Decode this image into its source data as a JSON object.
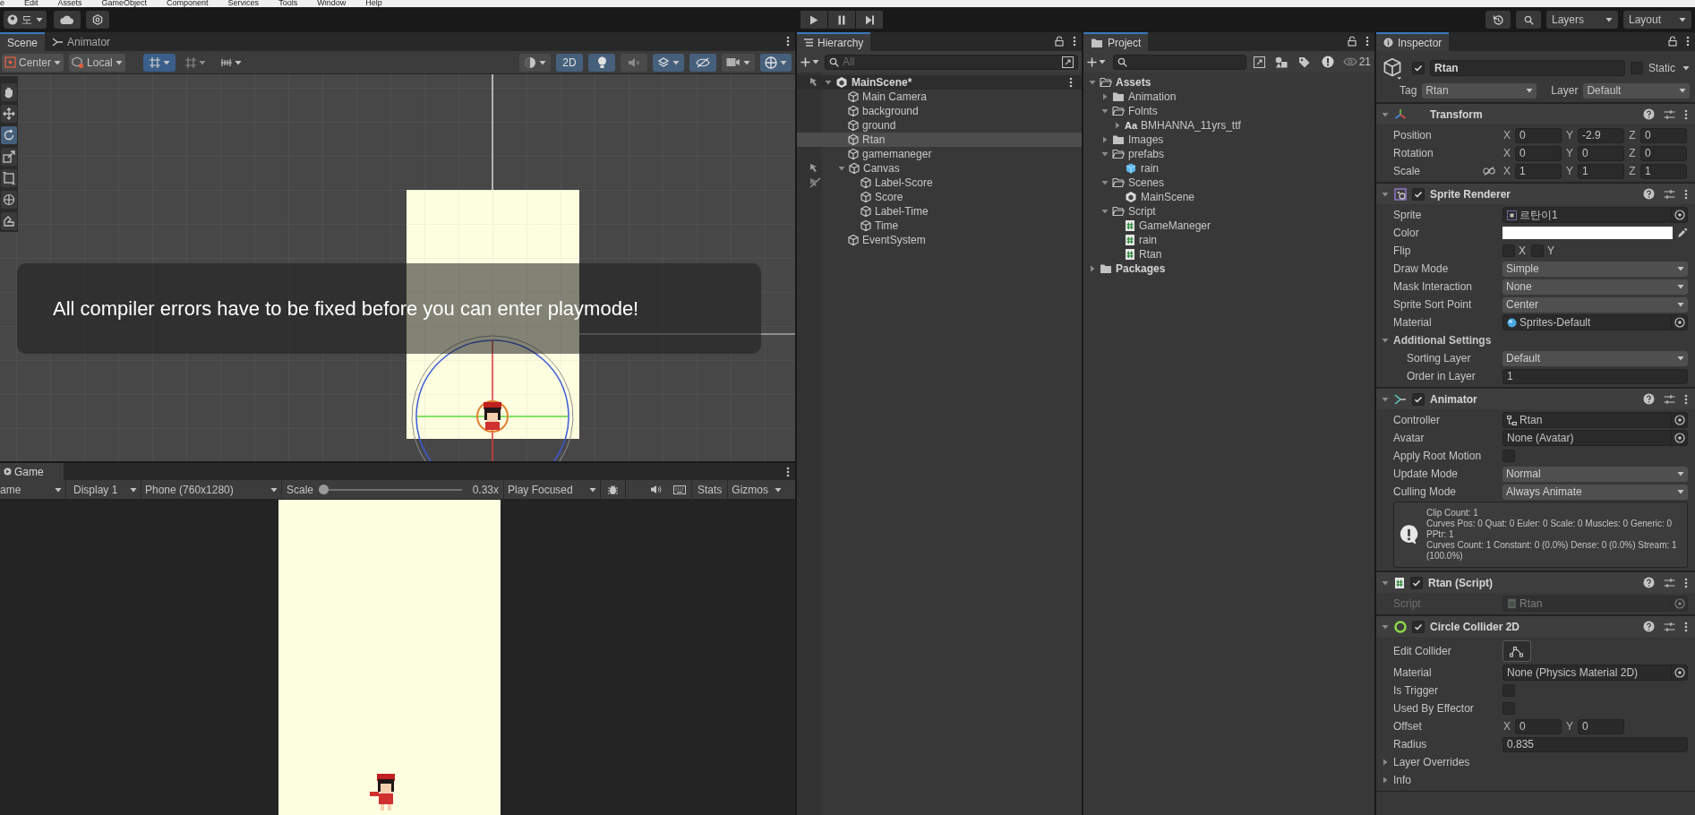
{
  "menu_bar": [
    "e",
    "Edit",
    "Assets",
    "GameObject",
    "Component",
    "Services",
    "Tools",
    "Window",
    "Help"
  ],
  "main_toolbar": {
    "account": "도",
    "layers": "Layers",
    "layout": "Layout"
  },
  "scene": {
    "tabs": [
      {
        "label": "Scene",
        "selected": true,
        "kind": "scene"
      },
      {
        "label": "Animator",
        "selected": false,
        "kind": "animator"
      }
    ],
    "pivot": "Center",
    "space": "Local",
    "toggles": [
      {
        "kind": "shading",
        "on": false
      },
      {
        "kind": "dimension",
        "label": "2D",
        "on": true
      },
      {
        "kind": "lighting",
        "on": true
      },
      {
        "kind": "audio",
        "on": false
      },
      {
        "kind": "effects",
        "on": true
      },
      {
        "kind": "visibility",
        "on": true
      },
      {
        "kind": "camera",
        "on": false
      },
      {
        "kind": "gizmos",
        "on": true
      }
    ],
    "tools": [
      {
        "kind": "hand",
        "selected": false
      },
      {
        "kind": "move",
        "selected": false
      },
      {
        "kind": "rotate",
        "selected": true
      },
      {
        "kind": "scale",
        "selected": false
      },
      {
        "kind": "rect",
        "selected": false
      },
      {
        "kind": "transform",
        "selected": false
      },
      {
        "kind": "custom",
        "selected": false
      }
    ],
    "message": "All compiler errors have to be fixed before you can enter playmode!"
  },
  "game": {
    "tab": "Game",
    "view": "ame",
    "display": "Display 1",
    "resolution": "Phone (760x1280)",
    "scale": {
      "label": "Scale",
      "level": 0,
      "value": "0.33x"
    },
    "play_mode": "Play Focused",
    "stats": "Stats",
    "gizmos": "Gizmos"
  },
  "hierarchy": {
    "title": "Hierarchy",
    "placeholder": "All",
    "scene": "MainScene*",
    "items": [
      {
        "label": "Main Camera",
        "selected": false
      },
      {
        "label": "background",
        "selected": false
      },
      {
        "label": "ground",
        "selected": false
      },
      {
        "label": "Rtan",
        "selected": true
      },
      {
        "label": "gamemaneger",
        "selected": false
      },
      {
        "label": "Canvas",
        "selected": false,
        "expanded": true,
        "pickable": true,
        "children": [
          {
            "label": "Label-Score",
            "selected": false,
            "pickable": false
          },
          {
            "label": "Score",
            "selected": false
          },
          {
            "label": "Label-Time",
            "selected": false
          },
          {
            "label": "Time",
            "selected": false
          }
        ]
      },
      {
        "label": "EventSystem",
        "selected": false
      }
    ]
  },
  "project": {
    "title": "Project",
    "count": "21",
    "items": [
      {
        "label": "Assets",
        "kind": "folder",
        "expanded": true,
        "selected": false,
        "children": [
          {
            "label": "Animation",
            "kind": "folder",
            "expanded": false,
            "selected": false
          },
          {
            "label": "Folnts",
            "kind": "folder",
            "expanded": true,
            "selected": false,
            "children": [
              {
                "label": "BMHANNA_11yrs_ttf",
                "kind": "font",
                "badge": "Aa",
                "expanded": false,
                "selected": false
              }
            ]
          },
          {
            "label": "Images",
            "kind": "folder",
            "expanded": false,
            "selected": false
          },
          {
            "label": "prefabs",
            "kind": "folder",
            "expanded": true,
            "selected": false,
            "children": [
              {
                "label": "rain",
                "kind": "prefab",
                "selected": false
              }
            ]
          },
          {
            "label": "Scenes",
            "kind": "folder",
            "expanded": true,
            "selected": false,
            "children": [
              {
                "label": "MainScene",
                "kind": "scene",
                "selected": false
              }
            ]
          },
          {
            "label": "Script",
            "kind": "folder",
            "expanded": true,
            "selected": false,
            "children": [
              {
                "label": "GameManeger",
                "kind": "script",
                "selected": false
              },
              {
                "label": "rain",
                "kind": "script",
                "selected": false
              },
              {
                "label": "Rtan",
                "kind": "script",
                "selected": false
              }
            ]
          }
        ]
      },
      {
        "label": "Packages",
        "kind": "folder",
        "expanded": false,
        "selected": false
      }
    ]
  },
  "inspector": {
    "title": "Inspector",
    "active": true,
    "name": "Rtan",
    "static": false,
    "static_label": "Static",
    "tag_label": "Tag",
    "tag": "Rtan",
    "layer_label": "Layer",
    "layer": "Default",
    "components": [
      {
        "title": "Transform",
        "kind": "transform",
        "expanded": true,
        "rows": [
          {
            "kind": "vector",
            "label": "Position",
            "fields": [
              {
                "axis": "X",
                "value": "0"
              },
              {
                "axis": "Y",
                "value": "-2.9"
              },
              {
                "axis": "Z",
                "value": "0"
              }
            ]
          },
          {
            "kind": "vector",
            "label": "Rotation",
            "fields": [
              {
                "axis": "X",
                "value": "0"
              },
              {
                "axis": "Y",
                "value": "0"
              },
              {
                "axis": "Z",
                "value": "0"
              }
            ]
          },
          {
            "kind": "vector",
            "label": "Scale",
            "linked": false,
            "fields": [
              {
                "axis": "X",
                "value": "1"
              },
              {
                "axis": "Y",
                "value": "1"
              },
              {
                "axis": "Z",
                "value": "1"
              }
            ]
          }
        ]
      },
      {
        "title": "Sprite Renderer",
        "kind": "sprite",
        "enabled": true,
        "expanded": true,
        "rows": [
          {
            "kind": "sprite",
            "label": "Sprite",
            "value": "르탄이1"
          },
          {
            "kind": "color",
            "label": "Color",
            "color": "#ffffff"
          },
          {
            "kind": "flip",
            "label": "Flip",
            "toggles": [
              {
                "axis": "X",
                "checked": false
              },
              {
                "axis": "Y",
                "checked": false
              }
            ]
          },
          {
            "kind": "dropdown",
            "label": "Draw Mode",
            "value": "Simple"
          },
          {
            "kind": "dropdown",
            "label": "Mask Interaction",
            "value": "None"
          },
          {
            "kind": "dropdown",
            "label": "Sprite Sort Point",
            "value": "Center"
          },
          {
            "kind": "material",
            "label": "Material",
            "value": "Sprites-Default"
          },
          {
            "kind": "section",
            "label": "Additional Settings",
            "expanded": true,
            "rows": [
              {
                "kind": "dropdown",
                "label": "Sorting Layer",
                "value": "Default"
              },
              {
                "kind": "field",
                "label": "Order in Layer",
                "value": "1"
              }
            ]
          }
        ]
      },
      {
        "title": "Animator",
        "kind": "animator",
        "enabled": true,
        "expanded": true,
        "rows": [
          {
            "kind": "controller",
            "label": "Controller",
            "value": "Rtan"
          },
          {
            "kind": "reference",
            "label": "Avatar",
            "value": "None (Avatar)"
          },
          {
            "kind": "checkbox",
            "label": "Apply Root Motion",
            "checked": false
          },
          {
            "kind": "dropdown",
            "label": "Update Mode",
            "value": "Normal"
          },
          {
            "kind": "dropdown",
            "label": "Culling Mode",
            "value": "Always Animate"
          },
          {
            "kind": "help",
            "lines": [
              "Clip Count: 1",
              "Curves Pos: 0 Quat: 0 Euler: 0 Scale: 0 Muscles: 0 Generic: 0",
              "PPtr: 1",
              "Curves Count: 1 Constant: 0 (0.0%) Dense: 0 (0.0%) Stream: 1 (100.0%)"
            ]
          }
        ]
      },
      {
        "title": "Rtan (Script)",
        "kind": "script",
        "enabled": true,
        "expanded": true,
        "rows": [
          {
            "kind": "script",
            "label": "Script",
            "value": "Rtan",
            "disabled": true
          }
        ]
      },
      {
        "title": "Circle Collider 2D",
        "kind": "collider",
        "enabled": true,
        "expanded": true,
        "rows": [
          {
            "kind": "button",
            "label": "Edit Collider"
          },
          {
            "kind": "reference",
            "label": "Material",
            "value": "None (Physics Material 2D)"
          },
          {
            "kind": "checkbox",
            "label": "Is Trigger",
            "checked": false
          },
          {
            "kind": "checkbox",
            "label": "Used By Effector",
            "checked": false
          },
          {
            "kind": "vector",
            "label": "Offset",
            "fields": [
              {
                "axis": "X",
                "value": "0"
              },
              {
                "axis": "Y",
                "value": "0"
              }
            ]
          },
          {
            "kind": "field",
            "label": "Radius",
            "value": "0.835"
          },
          {
            "kind": "foldout",
            "label": "Layer Overrides",
            "expanded": false
          },
          {
            "kind": "foldout",
            "label": "Info",
            "expanded": false
          }
        ]
      }
    ]
  }
}
